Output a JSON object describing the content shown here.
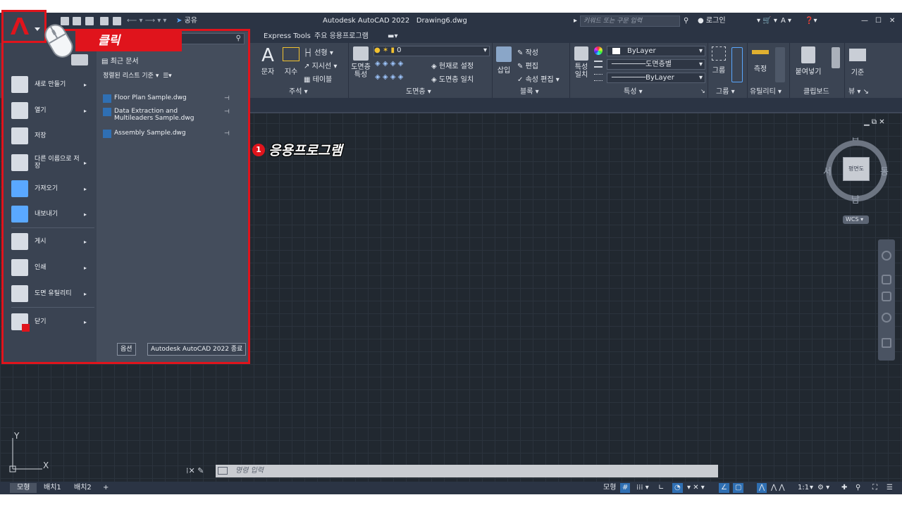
{
  "titlebar": {
    "app_title": "Autodesk AutoCAD 2022",
    "file_name": "Drawing6.dwg",
    "share_label": "공유",
    "search_placeholder": "키워드 또는 구문 입력",
    "login_label": "로그인"
  },
  "tabs": [
    "Express Tools",
    "주요 응용프로그램"
  ],
  "ribbon": {
    "annotation": {
      "text": "문자",
      "dimension": "지수",
      "linear": "선형",
      "leader": "지시선",
      "table": "테이블",
      "title": "주석"
    },
    "layers": {
      "props": "도면층 특성",
      "current_layer": "0",
      "set_current": "현재로 설정",
      "match": "도면층 일치",
      "title": "도면층"
    },
    "block": {
      "insert": "삽입",
      "create": "작성",
      "edit": "편집",
      "attr_edit": "속성 편집",
      "title": "블록"
    },
    "properties": {
      "match": "특성 일치",
      "color": "ByLayer",
      "linetype": "도면층별",
      "lineweight": "ByLayer",
      "title": "특성"
    },
    "groups": {
      "group": "그룹",
      "title": "그룹"
    },
    "utilities": {
      "measure": "측정",
      "title": "유틸리티"
    },
    "clipboard": {
      "paste": "붙여넣기",
      "title": "클립보드"
    },
    "view": {
      "base": "기준",
      "title": "뷰"
    }
  },
  "app_menu": {
    "recent_docs": "최근 문서",
    "sort_label": "정렬된 리스트 기준",
    "items": [
      {
        "label": "새로 만들기",
        "icon": "new-file-icon",
        "arrow": "▸"
      },
      {
        "label": "열기",
        "icon": "open-folder-icon",
        "arrow": "▸"
      },
      {
        "label": "저장",
        "icon": "save-icon",
        "arrow": ""
      },
      {
        "label": "다른 이름으로 저장",
        "icon": "save-as-icon",
        "arrow": "▸"
      },
      {
        "label": "가져오기",
        "icon": "import-icon",
        "arrow": "▸"
      },
      {
        "label": "내보내기",
        "icon": "export-icon",
        "arrow": "▸"
      },
      {
        "label": "게시",
        "icon": "publish-icon",
        "arrow": "▸"
      },
      {
        "label": "인쇄",
        "icon": "print-icon",
        "arrow": "▸"
      },
      {
        "label": "도면 유틸리티",
        "icon": "drawing-utilities-icon",
        "arrow": "▸"
      },
      {
        "label": "닫기",
        "icon": "close-file-icon",
        "arrow": "▸"
      }
    ],
    "recent_files": [
      {
        "name": "Floor Plan Sample.dwg"
      },
      {
        "name": "Data Extraction and Multileaders Sample.dwg"
      },
      {
        "name": "Assembly Sample.dwg"
      }
    ],
    "options_button": "옵션",
    "exit_button": "Autodesk AutoCAD 2022 종료"
  },
  "callouts": {
    "click_label": "클릭",
    "step_number": "1",
    "step_text": "응용프로그램"
  },
  "viewcube": {
    "north": "북",
    "south": "남",
    "east": "동",
    "west": "서",
    "face": "평면도",
    "wcs": "WCS"
  },
  "commandline": {
    "placeholder": "명령 입력"
  },
  "statusbar": {
    "layout_tabs": [
      "모형",
      "배치1",
      "배치2"
    ],
    "add_tab": "+",
    "model_label": "모형",
    "scale": "1:1"
  },
  "colors": {
    "accent_red": "#e0141c",
    "ribbon_bg": "#3b4453",
    "canvas_bg": "#212830"
  }
}
